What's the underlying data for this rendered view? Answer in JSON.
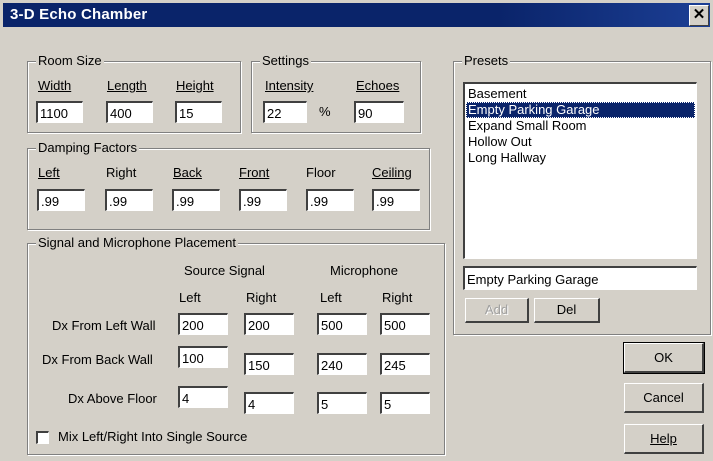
{
  "window": {
    "title": "3-D Echo Chamber",
    "close_label": "✕"
  },
  "room_size": {
    "legend": "Room Size",
    "width_label": "Width",
    "width_value": "1100",
    "length_label": "Length",
    "length_value": "400",
    "height_label": "Height",
    "height_value": "15"
  },
  "settings": {
    "legend": "Settings",
    "intensity_label": "Intensity",
    "intensity_value": "22",
    "percent": "%",
    "echoes_label": "Echoes",
    "echoes_value": "90"
  },
  "damping": {
    "legend": "Damping Factors",
    "left_label": "Left",
    "left_value": ".99",
    "right_label": "Right",
    "right_value": ".99",
    "back_label": "Back",
    "back_value": ".99",
    "front_label": "Front",
    "front_value": ".99",
    "floor_label": "Floor",
    "floor_value": ".99",
    "ceiling_label": "Ceiling",
    "ceiling_value": ".99"
  },
  "placement": {
    "legend": "Signal and Microphone Placement",
    "source_header": "Source Signal",
    "mic_header": "Microphone",
    "left_col": "Left",
    "right_col": "Right",
    "rows": [
      {
        "label": "Dx From Left Wall",
        "values": [
          "200",
          "200",
          "500",
          "500"
        ]
      },
      {
        "label": "Dx From Back Wall",
        "values": [
          "100",
          "150",
          "240",
          "245"
        ]
      },
      {
        "label": "Dx Above Floor",
        "values": [
          "4",
          "4",
          "5",
          "5"
        ]
      }
    ],
    "mix_label": "Mix Left/Right Into Single Source",
    "mix_checked": false
  },
  "presets": {
    "legend": "Presets",
    "items": [
      "Basement",
      "Empty Parking Garage",
      "Expand Small Room",
      "Hollow Out",
      "Long Hallway"
    ],
    "selected": "Empty Parking Garage",
    "name_value": "Empty Parking Garage",
    "add_label": "Add",
    "del_label": "Del"
  },
  "buttons": {
    "ok": "OK",
    "cancel": "Cancel",
    "help": "Help"
  }
}
